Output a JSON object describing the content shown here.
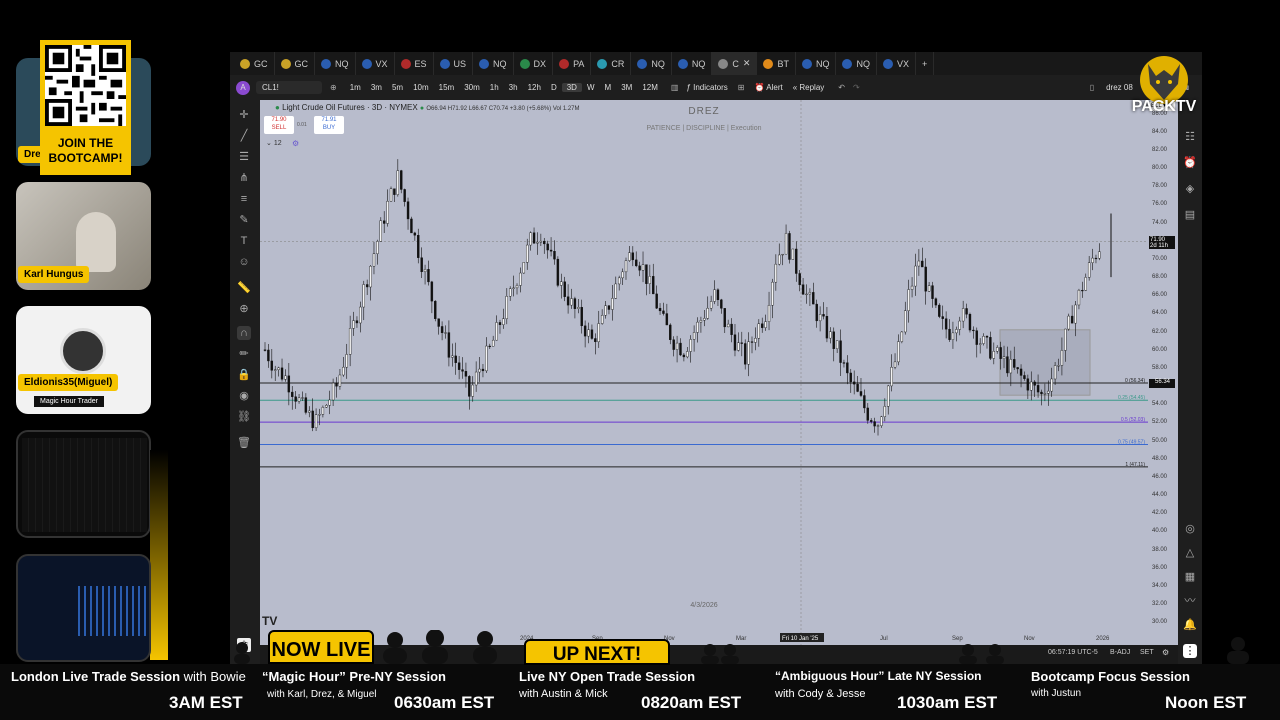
{
  "promo": {
    "line1": "JOIN THE",
    "line2": "BOOTCAMP!"
  },
  "cams": [
    {
      "name": "Dre"
    },
    {
      "name": "Karl Hungus"
    },
    {
      "name": "Eldionis35(Miguel)",
      "sub": "Magic Hour Trader"
    }
  ],
  "tabs": [
    {
      "label": "GC",
      "color": "#c9a227"
    },
    {
      "label": "GC",
      "color": "#c9a227"
    },
    {
      "label": "NQ",
      "color": "#2a5db0"
    },
    {
      "label": "VX",
      "color": "#2a5db0"
    },
    {
      "label": "ES",
      "color": "#b02a2a"
    },
    {
      "label": "US",
      "color": "#2a5db0"
    },
    {
      "label": "NQ",
      "color": "#2a5db0"
    },
    {
      "label": "DX",
      "color": "#2a8a4a"
    },
    {
      "label": "PA",
      "color": "#b02a2a"
    },
    {
      "label": "CR",
      "color": "#2a9ab0"
    },
    {
      "label": "NQ",
      "color": "#2a5db0"
    },
    {
      "label": "NQ",
      "color": "#2a5db0"
    },
    {
      "label": "C",
      "color": "#888888"
    },
    {
      "label": "BT",
      "color": "#e08a1a"
    },
    {
      "label": "NQ",
      "color": "#2a5db0"
    },
    {
      "label": "NQ",
      "color": "#2a5db0"
    },
    {
      "label": "VX",
      "color": "#2a5db0"
    }
  ],
  "toolbar": {
    "symbol": "CL1!",
    "timeframes": [
      "1m",
      "3m",
      "5m",
      "10m",
      "15m",
      "30m",
      "1h",
      "3h",
      "12h",
      "D",
      "3D",
      "W",
      "M",
      "3M",
      "12M"
    ],
    "active_tf": "3D",
    "indicators": "Indicators",
    "alert": "Alert",
    "replay": "Replay",
    "layout_name": "drez 08"
  },
  "chart": {
    "symbol_title": "Light Crude Oil Futures · 3D · NYMEX",
    "ohlc": "O66.94 H71.92 L66.67 C70.74 +3.80 (+5.68%) Vol 1.27M",
    "sell_price": "71.90",
    "sell_label": "SELL",
    "spread": "0.01",
    "buy_price": "71.91",
    "buy_label": "BUY",
    "indicator_count": "12",
    "watermark_title": "DREZ",
    "watermark_sub": "PATIENCE  |  DISCIPLINE  |  Execution",
    "date_label": "4/3/2026",
    "crosshair_date": "Fri 10 Jan '25",
    "x_labels": [
      "2024",
      "Sep",
      "Nov",
      "Mar",
      "May",
      "Jul",
      "Sep",
      "Nov",
      "2026",
      "Mar"
    ],
    "fib_levels": [
      {
        "label": "0 (56.34)",
        "price": 56.34,
        "color": "#222222"
      },
      {
        "label": "0.25 (54.45)",
        "price": 54.45,
        "color": "#3a9a8a"
      },
      {
        "label": "0.5 (52.03)",
        "price": 52.03,
        "color": "#6a3ad0"
      },
      {
        "label": "0.75 (49.57)",
        "price": 49.57,
        "color": "#3a6ad0"
      },
      {
        "label": "1 (47.11)",
        "price": 47.11,
        "color": "#222222"
      }
    ],
    "price_current": "71.90",
    "price_current_sub": "2d 11h",
    "price_line": "56.34",
    "y_ticks": [
      86,
      84,
      82,
      80,
      78,
      76,
      74,
      72,
      70,
      68,
      66,
      64,
      62,
      60,
      58,
      56,
      54,
      52,
      50,
      48,
      46,
      44,
      42,
      40,
      38,
      36,
      34,
      32,
      30
    ],
    "clock": "06:57:19 UTC-5",
    "b_adj": "B-ADJ",
    "set": "SET",
    "currency": "BLL"
  },
  "brand": {
    "name": "PACKTV"
  },
  "ticker": {
    "now_live": "NOW LIVE",
    "up_next": "UP NEXT!",
    "sessions": [
      {
        "title": "London Live Trade Session",
        "with": " with Bowie",
        "time": "3AM EST"
      },
      {
        "title": "“Magic Hour” Pre-NY Session",
        "with": "with Karl, Drez, & Miguel",
        "time": "0630am EST"
      },
      {
        "title": "Live NY Open Trade Session",
        "with": "with Austin & Mick",
        "time": "0820am EST"
      },
      {
        "title": "“Ambiguous Hour” Late NY Session",
        "with": "with Cody & Jesse",
        "time": "1030am EST"
      },
      {
        "title": "Bootcamp Focus Session",
        "with": "with Justun",
        "time": "Noon EST"
      }
    ]
  }
}
